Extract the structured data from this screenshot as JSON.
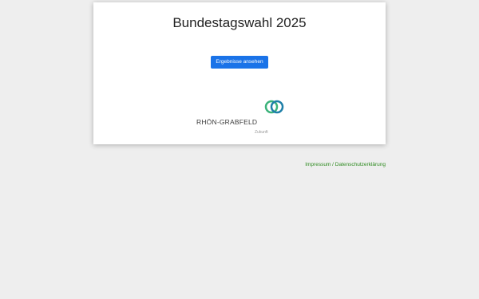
{
  "page": {
    "title": "Bundestagswahl 2025"
  },
  "button": {
    "label": "Ergebnisse ansehen"
  },
  "logo": {
    "text": "RHÖN-GRABFELD",
    "subtitle": "Zukunft",
    "icon": "double-ring-icon",
    "colors": {
      "ring_left": "#3bb27a",
      "ring_right": "#1e7fa8"
    }
  },
  "footer": {
    "link_label": "Impressum / Datenschutzerklärung",
    "link_color": "#2e8b20"
  },
  "colors": {
    "background": "#eeeeee",
    "card": "#ffffff",
    "accent": "#1a73e8"
  }
}
